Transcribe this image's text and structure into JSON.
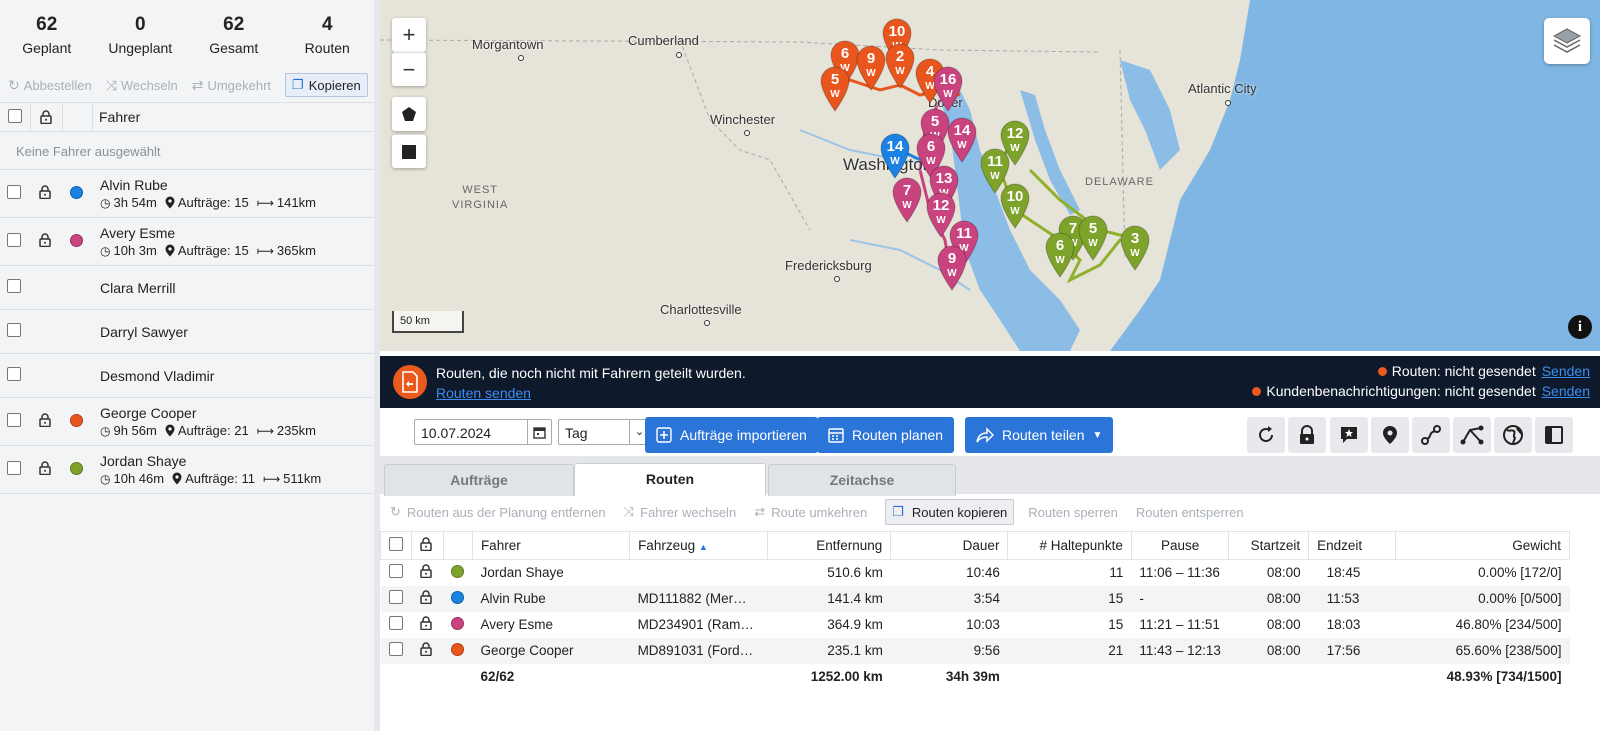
{
  "stats": [
    {
      "value": "62",
      "label": "Geplant"
    },
    {
      "value": "0",
      "label": "Ungeplant"
    },
    {
      "value": "62",
      "label": "Gesamt"
    },
    {
      "value": "4",
      "label": "Routen"
    }
  ],
  "left_toolbar": {
    "cancel": "Abbestellen",
    "switch": "Wechseln",
    "reverse": "Umgekehrt",
    "copy": "Kopieren"
  },
  "driver_header": "Fahrer",
  "no_driver": "Keine Fahrer ausgewählt",
  "drivers": [
    {
      "name": "Alvin Rube",
      "color": "#1a82e2",
      "time": "3h 54m",
      "orders": "Aufträge: 15",
      "dist": "141km",
      "locked": true
    },
    {
      "name": "Avery Esme",
      "color": "#c9437e",
      "time": "10h 3m",
      "orders": "Aufträge: 15",
      "dist": "365km",
      "locked": true
    },
    {
      "name": "Clara Merrill"
    },
    {
      "name": "Darryl Sawyer"
    },
    {
      "name": "Desmond Vladimir"
    },
    {
      "name": "George Cooper",
      "color": "#e8561e",
      "time": "9h 56m",
      "orders": "Aufträge: 21",
      "dist": "235km",
      "locked": true
    },
    {
      "name": "Jordan Shaye",
      "color": "#7ea32a",
      "time": "10h 46m",
      "orders": "Aufträge: 11",
      "dist": "511km",
      "locked": true
    }
  ],
  "map": {
    "cities": [
      "Morgantown",
      "Cumberland",
      "Winchester",
      "Washington",
      "Fredericksburg",
      "Charlottesville",
      "Atlantic City",
      "Dover"
    ],
    "regions": [
      "WEST\nVIRGINIA",
      "DELAWARE"
    ],
    "scale": "50 km",
    "pins": [
      {
        "n": "10",
        "c": "#e8561e"
      },
      {
        "n": "6",
        "c": "#e8561e"
      },
      {
        "n": "9",
        "c": "#e8561e"
      },
      {
        "n": "2",
        "c": "#e8561e"
      },
      {
        "n": "5",
        "c": "#e8561e"
      },
      {
        "n": "4",
        "c": "#e8561e"
      },
      {
        "n": "16",
        "c": "#c9437e"
      },
      {
        "n": "5",
        "c": "#c9437e"
      },
      {
        "n": "14",
        "c": "#c9437e"
      },
      {
        "n": "6",
        "c": "#c9437e"
      },
      {
        "n": "13",
        "c": "#c9437e"
      },
      {
        "n": "7",
        "c": "#c9437e"
      },
      {
        "n": "12",
        "c": "#c9437e"
      },
      {
        "n": "11",
        "c": "#c9437e"
      },
      {
        "n": "9",
        "c": "#c9437e"
      },
      {
        "n": "14",
        "c": "#1a82e2"
      },
      {
        "n": "12",
        "c": "#7ea32a"
      },
      {
        "n": "11",
        "c": "#7ea32a"
      },
      {
        "n": "10",
        "c": "#7ea32a"
      },
      {
        "n": "7",
        "c": "#7ea32a"
      },
      {
        "n": "5",
        "c": "#7ea32a"
      },
      {
        "n": "6",
        "c": "#7ea32a"
      },
      {
        "n": "3",
        "c": "#7ea32a"
      }
    ],
    "pin_label": "W"
  },
  "banner": {
    "message": "Routen, die noch nicht mit Fahrern geteilt wurden.",
    "link": "Routen senden",
    "status1": "Routen: nicht gesendet",
    "status2": "Kundenbenachrichtigungen: nicht gesendet",
    "send": "Senden"
  },
  "toolbar": {
    "date": "10.07.2024",
    "view": "Tag",
    "import": "Aufträge importieren",
    "plan": "Routen planen",
    "share": "Routen teilen"
  },
  "tabs": [
    "Aufträge",
    "Routen",
    "Zeitachse"
  ],
  "route_toolbar": {
    "remove": "Routen aus der Planung entfernen",
    "switch": "Fahrer wechseln",
    "reverse": "Route umkehren",
    "copy": "Routen kopieren",
    "lock": "Routen sperren",
    "unlock": "Routen entsperren"
  },
  "table": {
    "headers": [
      "Fahrer",
      "Fahrzeug",
      "Entfernung",
      "Dauer",
      "# Haltepunkte",
      "Pause",
      "Startzeit",
      "Endzeit",
      "Gewicht"
    ],
    "rows": [
      {
        "color": "#7ea32a",
        "driver": "Jordan Shaye",
        "vehicle": "",
        "dist": "510.6 km",
        "dur": "10:46",
        "stops": "11",
        "pause": "11:06 – 11:36",
        "start": "08:00",
        "end": "18:45",
        "weight": "0.00% [172/0]"
      },
      {
        "color": "#1a82e2",
        "driver": "Alvin Rube",
        "vehicle": "MD111882 (Mer…",
        "dist": "141.4 km",
        "dur": "3:54",
        "stops": "15",
        "pause": "-",
        "start": "08:00",
        "end": "11:53",
        "weight": "0.00% [0/500]"
      },
      {
        "color": "#c9437e",
        "driver": "Avery Esme",
        "vehicle": "MD234901 (Ram…",
        "dist": "364.9 km",
        "dur": "10:03",
        "stops": "15",
        "pause": "11:21 – 11:51",
        "start": "08:00",
        "end": "18:03",
        "weight": "46.80% [234/500]"
      },
      {
        "color": "#e8561e",
        "driver": "George Cooper",
        "vehicle": "MD891031 (Ford…",
        "dist": "235.1 km",
        "dur": "9:56",
        "stops": "21",
        "pause": "11:43 – 12:13",
        "start": "08:00",
        "end": "17:56",
        "weight": "65.60% [238/500]"
      }
    ],
    "footer": {
      "count": "62/62",
      "dist": "1252.00 km",
      "dur": "34h 39m",
      "weight": "48.93% [734/1500]"
    }
  }
}
